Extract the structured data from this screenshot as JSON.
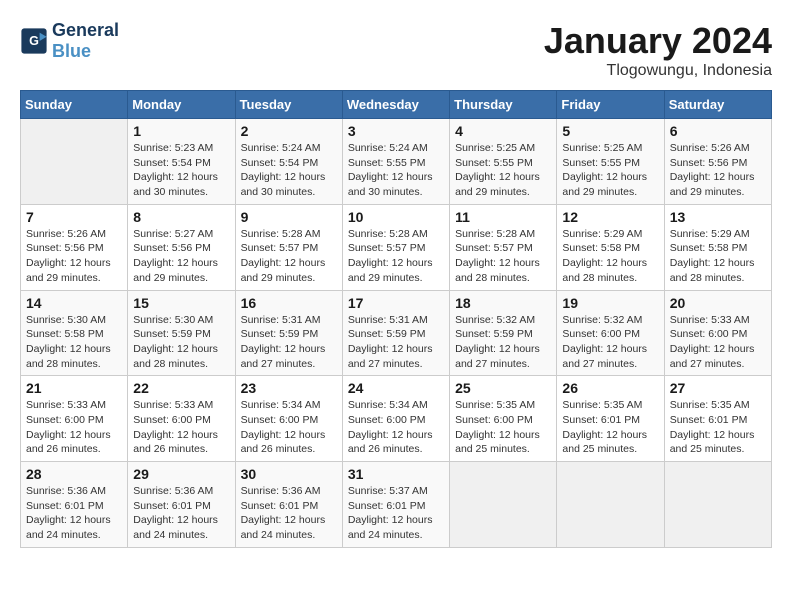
{
  "header": {
    "logo_line1": "General",
    "logo_line2": "Blue",
    "month": "January 2024",
    "location": "Tlogowungu, Indonesia"
  },
  "days_of_week": [
    "Sunday",
    "Monday",
    "Tuesday",
    "Wednesday",
    "Thursday",
    "Friday",
    "Saturday"
  ],
  "weeks": [
    [
      {
        "day": "",
        "info": ""
      },
      {
        "day": "1",
        "info": "Sunrise: 5:23 AM\nSunset: 5:54 PM\nDaylight: 12 hours\nand 30 minutes."
      },
      {
        "day": "2",
        "info": "Sunrise: 5:24 AM\nSunset: 5:54 PM\nDaylight: 12 hours\nand 30 minutes."
      },
      {
        "day": "3",
        "info": "Sunrise: 5:24 AM\nSunset: 5:55 PM\nDaylight: 12 hours\nand 30 minutes."
      },
      {
        "day": "4",
        "info": "Sunrise: 5:25 AM\nSunset: 5:55 PM\nDaylight: 12 hours\nand 29 minutes."
      },
      {
        "day": "5",
        "info": "Sunrise: 5:25 AM\nSunset: 5:55 PM\nDaylight: 12 hours\nand 29 minutes."
      },
      {
        "day": "6",
        "info": "Sunrise: 5:26 AM\nSunset: 5:56 PM\nDaylight: 12 hours\nand 29 minutes."
      }
    ],
    [
      {
        "day": "7",
        "info": "Sunrise: 5:26 AM\nSunset: 5:56 PM\nDaylight: 12 hours\nand 29 minutes."
      },
      {
        "day": "8",
        "info": "Sunrise: 5:27 AM\nSunset: 5:56 PM\nDaylight: 12 hours\nand 29 minutes."
      },
      {
        "day": "9",
        "info": "Sunrise: 5:28 AM\nSunset: 5:57 PM\nDaylight: 12 hours\nand 29 minutes."
      },
      {
        "day": "10",
        "info": "Sunrise: 5:28 AM\nSunset: 5:57 PM\nDaylight: 12 hours\nand 29 minutes."
      },
      {
        "day": "11",
        "info": "Sunrise: 5:28 AM\nSunset: 5:57 PM\nDaylight: 12 hours\nand 28 minutes."
      },
      {
        "day": "12",
        "info": "Sunrise: 5:29 AM\nSunset: 5:58 PM\nDaylight: 12 hours\nand 28 minutes."
      },
      {
        "day": "13",
        "info": "Sunrise: 5:29 AM\nSunset: 5:58 PM\nDaylight: 12 hours\nand 28 minutes."
      }
    ],
    [
      {
        "day": "14",
        "info": "Sunrise: 5:30 AM\nSunset: 5:58 PM\nDaylight: 12 hours\nand 28 minutes."
      },
      {
        "day": "15",
        "info": "Sunrise: 5:30 AM\nSunset: 5:59 PM\nDaylight: 12 hours\nand 28 minutes."
      },
      {
        "day": "16",
        "info": "Sunrise: 5:31 AM\nSunset: 5:59 PM\nDaylight: 12 hours\nand 27 minutes."
      },
      {
        "day": "17",
        "info": "Sunrise: 5:31 AM\nSunset: 5:59 PM\nDaylight: 12 hours\nand 27 minutes."
      },
      {
        "day": "18",
        "info": "Sunrise: 5:32 AM\nSunset: 5:59 PM\nDaylight: 12 hours\nand 27 minutes."
      },
      {
        "day": "19",
        "info": "Sunrise: 5:32 AM\nSunset: 6:00 PM\nDaylight: 12 hours\nand 27 minutes."
      },
      {
        "day": "20",
        "info": "Sunrise: 5:33 AM\nSunset: 6:00 PM\nDaylight: 12 hours\nand 27 minutes."
      }
    ],
    [
      {
        "day": "21",
        "info": "Sunrise: 5:33 AM\nSunset: 6:00 PM\nDaylight: 12 hours\nand 26 minutes."
      },
      {
        "day": "22",
        "info": "Sunrise: 5:33 AM\nSunset: 6:00 PM\nDaylight: 12 hours\nand 26 minutes."
      },
      {
        "day": "23",
        "info": "Sunrise: 5:34 AM\nSunset: 6:00 PM\nDaylight: 12 hours\nand 26 minutes."
      },
      {
        "day": "24",
        "info": "Sunrise: 5:34 AM\nSunset: 6:00 PM\nDaylight: 12 hours\nand 26 minutes."
      },
      {
        "day": "25",
        "info": "Sunrise: 5:35 AM\nSunset: 6:00 PM\nDaylight: 12 hours\nand 25 minutes."
      },
      {
        "day": "26",
        "info": "Sunrise: 5:35 AM\nSunset: 6:01 PM\nDaylight: 12 hours\nand 25 minutes."
      },
      {
        "day": "27",
        "info": "Sunrise: 5:35 AM\nSunset: 6:01 PM\nDaylight: 12 hours\nand 25 minutes."
      }
    ],
    [
      {
        "day": "28",
        "info": "Sunrise: 5:36 AM\nSunset: 6:01 PM\nDaylight: 12 hours\nand 24 minutes."
      },
      {
        "day": "29",
        "info": "Sunrise: 5:36 AM\nSunset: 6:01 PM\nDaylight: 12 hours\nand 24 minutes."
      },
      {
        "day": "30",
        "info": "Sunrise: 5:36 AM\nSunset: 6:01 PM\nDaylight: 12 hours\nand 24 minutes."
      },
      {
        "day": "31",
        "info": "Sunrise: 5:37 AM\nSunset: 6:01 PM\nDaylight: 12 hours\nand 24 minutes."
      },
      {
        "day": "",
        "info": ""
      },
      {
        "day": "",
        "info": ""
      },
      {
        "day": "",
        "info": ""
      }
    ]
  ]
}
